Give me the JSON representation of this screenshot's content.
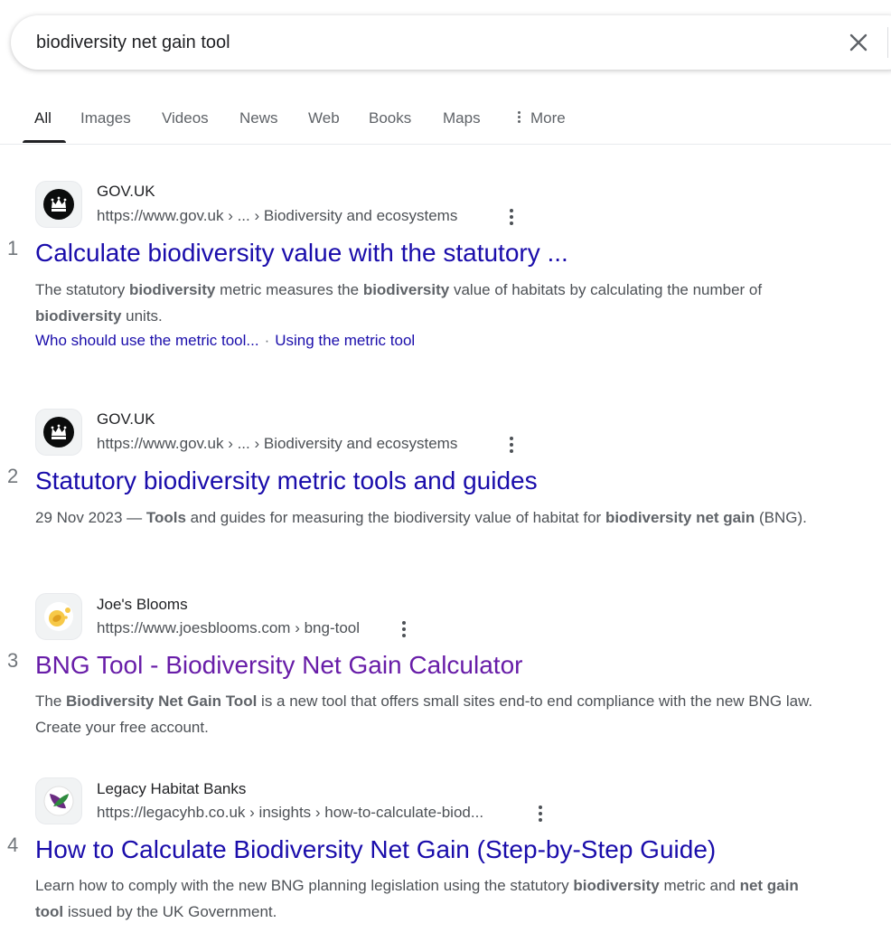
{
  "search": {
    "query": "biodiversity net gain tool"
  },
  "tabs": [
    {
      "label": "All",
      "active": true
    },
    {
      "label": "Images"
    },
    {
      "label": "Videos"
    },
    {
      "label": "News"
    },
    {
      "label": "Web"
    },
    {
      "label": "Books"
    },
    {
      "label": "Maps"
    },
    {
      "label": "More"
    }
  ],
  "results": [
    {
      "rank": "1",
      "site": "GOV.UK",
      "url": "https://www.gov.uk › ... › Biodiversity and ecosystems",
      "title": "Calculate biodiversity value with the statutory ...",
      "snippet": [
        {
          "t": "The statutory "
        },
        {
          "b": "biodiversity"
        },
        {
          "t": " metric measures the "
        },
        {
          "b": "biodiversity"
        },
        {
          "t": " value of habitats by calculating the number of "
        },
        {
          "b": "biodiversity"
        },
        {
          "t": " units."
        }
      ],
      "sitelinks": [
        "Who should use the metric tool...",
        "Using the metric tool"
      ],
      "sitelink_separator": "·",
      "icon": "crown-logo-icon"
    },
    {
      "rank": "2",
      "site": "GOV.UK",
      "url": "https://www.gov.uk › ... › Biodiversity and ecosystems",
      "title": "Statutory biodiversity metric tools and guides",
      "snippet": [
        {
          "t": "29 Nov 2023 — "
        },
        {
          "b": "Tools"
        },
        {
          "t": " and guides for measuring the biodiversity value of habitat for "
        },
        {
          "b": "biodiversity net gain"
        },
        {
          "t": " (BNG)."
        }
      ],
      "icon": "crown-logo-icon"
    },
    {
      "rank": "3",
      "site": "Joe's Blooms",
      "url": "https://www.joesblooms.com › bng-tool",
      "title": "BNG Tool - Biodiversity Net Gain Calculator",
      "visited": true,
      "snippet": [
        {
          "t": "The "
        },
        {
          "b": "Biodiversity Net Gain Tool"
        },
        {
          "t": " is a new tool that offers small sites end-to end compliance with the new BNG law. Create your free account."
        }
      ],
      "icon": "bee-logo-icon"
    },
    {
      "rank": "4",
      "site": "Legacy Habitat Banks",
      "url": "https://legacyhb.co.uk › insights › how-to-calculate-biod...",
      "title": "How to Calculate Biodiversity Net Gain (Step-by-Step Guide)",
      "snippet": [
        {
          "t": "Learn how to comply with the new BNG planning legislation using the statutory "
        },
        {
          "b": "biodiversity"
        },
        {
          "t": " metric and "
        },
        {
          "b": "net gain tool"
        },
        {
          "t": " issued by the UK Government."
        }
      ],
      "icon": "leaf-logo-icon"
    }
  ],
  "colors": {
    "link": "#1a0dab",
    "visited": "#681da8",
    "snippet": "#4d5156",
    "muted": "#70757a"
  }
}
